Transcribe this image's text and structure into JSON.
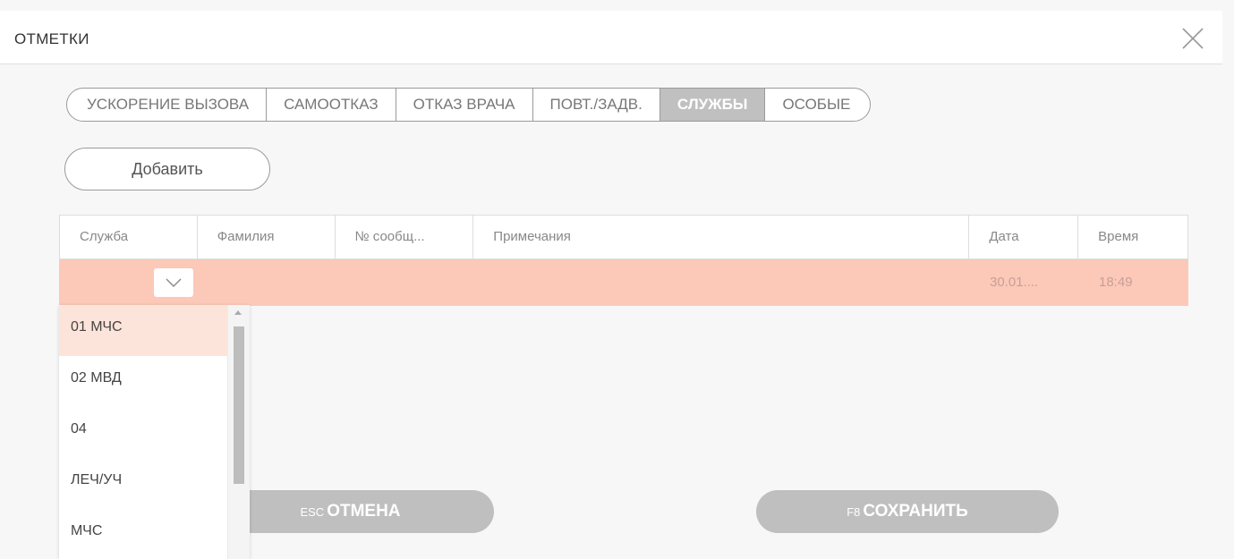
{
  "dialog": {
    "title": "ОТМЕТКИ",
    "close_icon": "close-icon"
  },
  "tabs": [
    {
      "label": "УСКОРЕНИЕ ВЫЗОВА",
      "active": false
    },
    {
      "label": "САМООТКАЗ",
      "active": false
    },
    {
      "label": "ОТКАЗ ВРАЧА",
      "active": false
    },
    {
      "label": "ПОВТ./ЗАДВ.",
      "active": false
    },
    {
      "label": "СЛУЖБЫ",
      "active": true
    },
    {
      "label": "ОСОБЫЕ",
      "active": false
    }
  ],
  "add_button": {
    "label": "Добавить"
  },
  "grid": {
    "columns": [
      "Служба",
      "Фамилия",
      "№ сообщ...",
      "Примечания",
      "Дата",
      "Время"
    ],
    "rows": [
      {
        "service": "",
        "surname": "",
        "message_no": "",
        "notes": "",
        "date": "30.01....",
        "time": "18:49"
      }
    ]
  },
  "dropdown": {
    "icon": "chevron-down-icon",
    "selected_index": 0,
    "options": [
      "01 МЧС",
      "02 МВД",
      "04",
      "ЛЕЧ/УЧ",
      "МЧС"
    ]
  },
  "footer": {
    "cancel": {
      "key": "ESC",
      "label": "ОТМЕНА"
    },
    "save": {
      "key": "F8",
      "label": "СОХРАНИТЬ"
    }
  },
  "colors": {
    "active_tab": "#c0c0c0",
    "selected_row": "#fcc8b8",
    "selected_option": "#fde4da",
    "footer_buttons": "#bfbfbf"
  }
}
